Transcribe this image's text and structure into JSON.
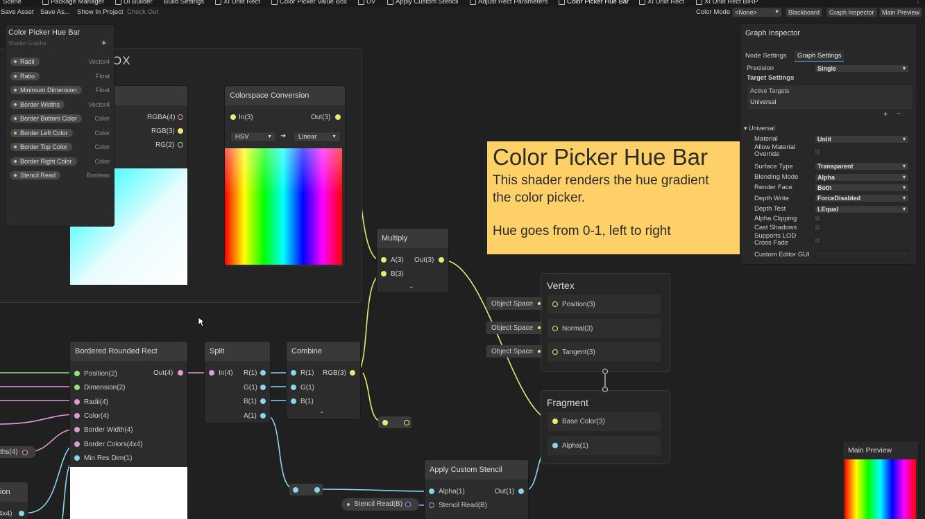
{
  "tabs": [
    "Scene",
    "Package Manager",
    "UI Builder",
    "Build Settings",
    "XI Unlit Rect",
    "Color Picker Value Box",
    "UV",
    "Apply Custom Stencil",
    "Adjust Rect Parameters",
    "Color Picker Hue Bar",
    "XI Unlit Rect",
    "XI Unlit Rect BIRP"
  ],
  "toolbar": {
    "save_asset": "Save Asset",
    "save_as": "Save As...",
    "show_in_project": "Show In Project",
    "check_out": "Check Out",
    "color_mode_label": "Color Mode",
    "color_mode_value": "<None>",
    "blackboard": "Blackboard",
    "graph_inspector": "Graph Inspector",
    "main_preview": "Main Preview"
  },
  "blackboard": {
    "title": "Color Picker Hue Bar",
    "subtitle": "Shader Graphs",
    "add": "+",
    "properties": [
      {
        "name": "Radii",
        "type": "Vector4"
      },
      {
        "name": "Ratio",
        "type": "Float"
      },
      {
        "name": "Minimum Dimension",
        "type": "Float"
      },
      {
        "name": "Border Widths",
        "type": "Vector4"
      },
      {
        "name": "Border Bottom Color",
        "type": "Color"
      },
      {
        "name": "Border Left Color",
        "type": "Color"
      },
      {
        "name": "Border Top Color",
        "type": "Color"
      },
      {
        "name": "Border Right Color",
        "type": "Color"
      },
      {
        "name": "Stencil Read",
        "type": "Boolean"
      }
    ]
  },
  "group_title_fragment": "OX",
  "nodes": {
    "uv_outputs": [
      "RGBA(4)",
      "RGB(3)",
      "RG(2)"
    ],
    "colorspace": {
      "title": "Colorspace Conversion",
      "in": "In(3)",
      "out": "Out(3)",
      "from": "HSV",
      "arrow": "➜",
      "to": "Linear"
    },
    "multiply": {
      "title": "Multiply",
      "a": "A(3)",
      "b": "B(3)",
      "out": "Out(3)"
    },
    "bordered": {
      "title": "Bordered Rounded Rect",
      "inputs": [
        "Position(2)",
        "Dimension(2)",
        "Radii(4)",
        "Color(4)",
        "Border Width(4)",
        "Border Colors(4x4)",
        "Min Res Dim(1)"
      ],
      "out": "Out(4)"
    },
    "split": {
      "title": "Split",
      "in": "In(4)",
      "outs": [
        "R(1)",
        "G(1)",
        "B(1)",
        "A(1)"
      ]
    },
    "combine": {
      "title": "Combine",
      "ins": [
        "R(1)",
        "G(1)",
        "B(1)"
      ],
      "out": "RGB(3)"
    },
    "stencil": {
      "title": "Apply Custom Stencil",
      "ins": [
        "Alpha(1)",
        "Stencil Read(B)"
      ],
      "out": "Out(1)"
    },
    "stencil_prop": "Stencil Read(B)",
    "border_widths_prop": "ths(4)",
    "left_partial": "ion",
    "left_partial2": "4x4)",
    "vertex": {
      "title": "Vertex",
      "slots": [
        "Position(3)",
        "Normal(3)",
        "Tangent(3)"
      ],
      "space": "Object Space"
    },
    "fragment": {
      "title": "Fragment",
      "slots": [
        "Base Color(3)",
        "Alpha(1)"
      ]
    }
  },
  "sticky": {
    "title": "Color Picker Hue Bar",
    "line1": "This shader renders the hue gradient",
    "line2": "the color picker.",
    "line3": "Hue goes from 0-1, left to right"
  },
  "inspector": {
    "title": "Graph Inspector",
    "tab_node": "Node Settings",
    "tab_graph": "Graph Settings",
    "precision_label": "Precision",
    "precision": "Single",
    "target_settings": "Target Settings",
    "active_targets": "Active Targets",
    "target": "Universal",
    "plus": "+",
    "minus": "−",
    "universal": "Universal",
    "material_label": "Material",
    "material": "Unlit",
    "allow_override": "Allow Material Override",
    "surface_label": "Surface Type",
    "surface": "Transparent",
    "blend_label": "Blending Mode",
    "blend": "Alpha",
    "face_label": "Render Face",
    "face": "Both",
    "dwrite_label": "Depth Write",
    "dwrite": "ForceDisabled",
    "dtest_label": "Depth Test",
    "dtest": "LEqual",
    "alpha_clip": "Alpha Clipping",
    "cast_shadows": "Cast Shadows",
    "lod": "Supports LOD Cross Fade",
    "custom_gui": "Custom Editor GUI"
  },
  "main_preview": {
    "title": "Main Preview"
  }
}
